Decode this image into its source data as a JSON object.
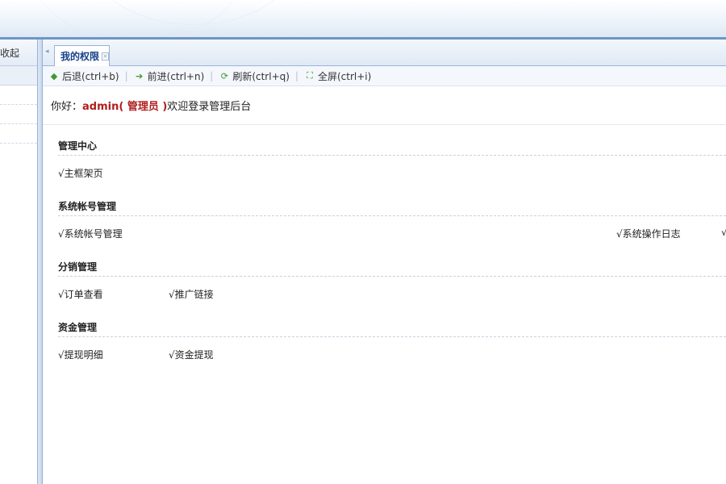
{
  "sidebar": {
    "header_label": "刚收起"
  },
  "tabs": [
    {
      "label": "我的权限",
      "close": "×"
    }
  ],
  "toolbar": {
    "back": "后退(ctrl+b)",
    "forward": "前进(ctrl+n)",
    "refresh": "刷新(ctrl+q)",
    "fullscreen": "全屏(ctrl+i)"
  },
  "welcome": {
    "greeting": "你好：",
    "user": "admin( 管理员 )",
    "suffix": " 欢迎登录管理后台"
  },
  "sections": [
    {
      "title": "管理中心",
      "items": [
        "√主框架页"
      ]
    },
    {
      "title": "系统帐号管理",
      "items": [
        "√系统帐号管理",
        "√系统操作日志",
        "√"
      ]
    },
    {
      "title": "分销管理",
      "items": [
        "√订单查看",
        "√推广链接"
      ]
    },
    {
      "title": "资金管理",
      "items": [
        "√提现明细",
        "√资金提现"
      ]
    }
  ],
  "colors": {
    "accent": "#6d96c7",
    "user_name": "#b01e1e",
    "tab_text": "#15428b"
  }
}
